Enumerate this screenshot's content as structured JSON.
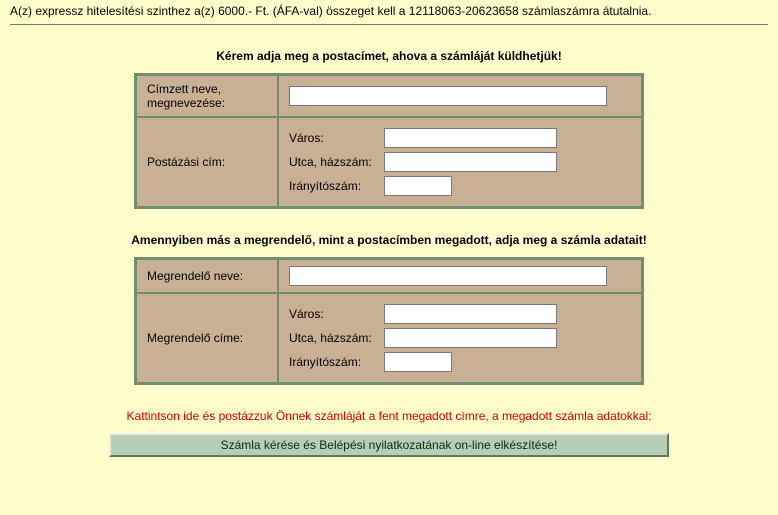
{
  "intro": "A(z) expressz hitelesítési szinthez a(z) 6000.- Ft. (ÁFA-val) összeget kell a 12118063-20623658 számlaszámra átutalnia.",
  "heading1": "Kérem adja meg a postacímet, ahova a számláját küldhetjük!",
  "table1": {
    "row1_label1": "Címzett neve,",
    "row1_label2": "megnevezése:",
    "row2_label": "Postázási cím:",
    "city_label": "Város:",
    "street_label": "Utca, házszám:",
    "zip_label": "Irányítószám:"
  },
  "heading2": "Amennyiben más a megrendelő, mint a postacímben megadott, adja meg a számla adatait!",
  "table2": {
    "row1_label": "Megrendelő neve:",
    "row2_label": "Megrendelő címe:",
    "city_label": "Város:",
    "street_label": "Utca, házszám:",
    "zip_label": "Irányítószám:"
  },
  "red_msg": "Kattintson ide és postázzuk Önnek számláját a fent megadott címre, a megadott számla adatokkal:",
  "button_label": "Számla kérése és Belépési nyilatkozatának on-line elkészítése!"
}
